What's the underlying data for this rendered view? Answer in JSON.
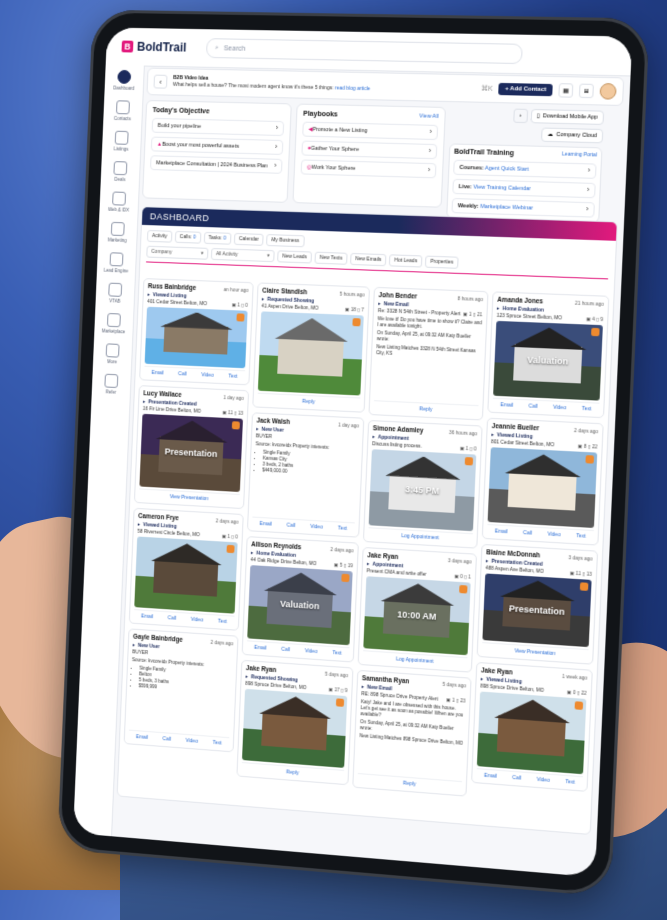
{
  "topbar": {
    "logo": "BoldTrail",
    "search_placeholder": "Search"
  },
  "sidebar": [
    {
      "label": "Dashboard"
    },
    {
      "label": "Contacts"
    },
    {
      "label": "Listings"
    },
    {
      "label": "Deals"
    },
    {
      "label": "Web & IDX"
    },
    {
      "label": "Marketing"
    },
    {
      "label": "Lead Engine"
    },
    {
      "label": "VTAB"
    },
    {
      "label": "Marketplace"
    },
    {
      "label": "More"
    },
    {
      "label": "Refer"
    }
  ],
  "tip": {
    "title": "B2B Video Idea",
    "text": "What helps sell a house? The most modern agent know it's these 5 things:",
    "link": "read blog article",
    "shortcut": "⌘K",
    "add_contact": "Add Contact"
  },
  "objective": {
    "title": "Today's Objective",
    "items": [
      "Build your pipeline",
      "Boost your most powerful assets",
      "Marketplace Consultation | 2024 Business Plan"
    ]
  },
  "playbooks": {
    "title": "Playbooks",
    "view_all": "View All",
    "items": [
      "Promote a New Listing",
      "Gather Your Sphere",
      "Work Your Sphere"
    ]
  },
  "quick": {
    "download": "Download Mobile App",
    "cloud": "Company Cloud"
  },
  "training": {
    "title": "BoldTrail Training",
    "portal": "Learning Portal",
    "rows": [
      {
        "label": "Courses:",
        "link": "Agent Quick Start"
      },
      {
        "label": "Live:",
        "link": "View Training Calendar"
      },
      {
        "label": "Weekly:",
        "link": "Marketplace Webinar"
      }
    ]
  },
  "dashboard": {
    "title": "DASHBOARD",
    "tabs": [
      {
        "label": "Activity",
        "count": ""
      },
      {
        "label": "Calls:",
        "count": "0"
      },
      {
        "label": "Tasks:",
        "count": "0"
      },
      {
        "label": "Calendar",
        "count": ""
      },
      {
        "label": "My Business",
        "count": ""
      }
    ],
    "select_company": "Company",
    "select_activity": "All Activity",
    "quick_filters": [
      "New Leads",
      "New Texts",
      "New Emails",
      "Hot Leads",
      "Properties"
    ]
  },
  "action_labels": {
    "email": "Email",
    "call": "Call",
    "video": "Video",
    "text": "Text",
    "reply": "Reply",
    "view_presentation": "View Presentation",
    "log_appointment": "Log Appointment"
  },
  "columns": [
    [
      {
        "name": "Russ Bainbridge",
        "time": "an hour ago",
        "type": "Viewed Listing",
        "addr": "401 Cedar Street Belton, MO",
        "meta": "▣ 1  ▯ 0",
        "pic": "pool",
        "h": 104,
        "actions": "full"
      },
      {
        "name": "Lucy Wallace",
        "time": "1 day ago",
        "type": "Presentation Created",
        "addr": "16 Fir Line Drive Belton, MO",
        "meta": "▣ 11 ▯ 13",
        "pic": "dusk",
        "overlay": "Presentation",
        "h": 120,
        "actions": "presentation"
      },
      {
        "name": "Cameron Frye",
        "time": "2 days ago",
        "type": "Viewed Listing",
        "addr": "58 Riverrest Circle Belton, MO",
        "meta": "▣ 1 ▯ 0",
        "pic": "aframe",
        "h": 118,
        "actions": "full"
      },
      {
        "name": "Gayle Bainbridge",
        "time": "2 days ago",
        "type": "New User",
        "addr": "BUYER",
        "body": "Source: kvcoreidx Property interests:",
        "list": [
          "Single Family",
          "Belton",
          "5 beds, 3 baths",
          "$599,999"
        ],
        "h": 118,
        "actions": "full"
      }
    ],
    [
      {
        "name": "Claire Standish",
        "time": "5 hours ago",
        "type": "Requested Showing",
        "addr": "41 Aspen Drive Belton, MO",
        "meta": "▣ 18 ▯ 7",
        "pic": "garden",
        "h": 126,
        "actions": "reply"
      },
      {
        "name": "Jack Walsh",
        "time": "1 day ago",
        "type": "New User",
        "addr": "BUYER",
        "body": "Source: kvcoreidx Property interests:",
        "list": [
          "Single Family",
          "Kansas City",
          "3 beds, 2 baths",
          "$449,000.00"
        ],
        "h": 120,
        "actions": "full"
      },
      {
        "name": "Allison Reynolds",
        "time": "2 days ago",
        "type": "Home Evaluation",
        "addr": "44 Oak Ridge Drive Belton, MO",
        "meta": "▣ 5 ▯ 19",
        "pic": "valuation",
        "overlay": "Valuation",
        "h": 120,
        "actions": "full"
      },
      {
        "name": "Jake Ryan",
        "time": "5 days ago",
        "type": "Requested Showing",
        "addr": "898 Spruce Drive Belton, MO",
        "meta": "▣ 17 ▯ 9",
        "pic": "forest",
        "h": 118,
        "actions": "reply"
      }
    ],
    [
      {
        "name": "John Bender",
        "time": "8 hours ago",
        "type": "New Email",
        "addr": "Re: 3328 N 54th Street - Property Alert",
        "meta": "▣ 1 ▯ 21",
        "body": "We love it! Do you have time to show it? Claire and I are available tonight.",
        "body2": "On Sunday, April 25, at 09:32 AM Katy Bueller wrote:",
        "body3": "New Listing Matches 3328 N 54th Street Kansas City, KS",
        "h": 128,
        "actions": "reply"
      },
      {
        "name": "Simone Adamley",
        "time": "36 hours ago",
        "type": "Appointment",
        "addr": "Discuss listing process.",
        "meta": "▣ 1 ▯ 0",
        "pic": "modern",
        "overlay": "3:45 PM",
        "h": 122,
        "actions": "log"
      },
      {
        "name": "Jake Ryan",
        "time": "3 days ago",
        "type": "Appointment",
        "addr": "Present CMA and write offer",
        "meta": "▣ 0 ▯ 1",
        "pic": "craftsman",
        "overlay": "10:00 AM",
        "h": 118,
        "actions": "log"
      },
      {
        "name": "Samantha Ryan",
        "time": "5 days ago",
        "type": "New Email",
        "addr": "RE: 898 Spruce Drive Property Alert",
        "meta": "▣ 1 ▯ 23",
        "body": "Katy! Jake and I are obsessed with this house. Let's get see it as soon as possible! When are you available?",
        "body2": "On Sunday, April 25, at 09:32 AM Katy Bueller wrote:",
        "body3": "New Listing Matches 898 Spruce Drive Belton, MO",
        "h": 118,
        "actions": "reply"
      }
    ],
    [
      {
        "name": "Amanda Jones",
        "time": "21 hours ago",
        "type": "Home Evaluation",
        "addr": "123 Spruce Street Belton, MO",
        "meta": "▣ 4 ▯ 9",
        "pic": "evalnight",
        "overlay": "Valuation",
        "h": 120,
        "actions": "full"
      },
      {
        "name": "Jeannie Bueller",
        "time": "2 days ago",
        "type": "Viewed Listing",
        "addr": "801 Cedar Street Belton, MO",
        "meta": "▣ 8 ▯ 22",
        "pic": "modern2",
        "h": 120,
        "actions": "full"
      },
      {
        "name": "Blaine McDonnah",
        "time": "3 days ago",
        "type": "Presentation Created",
        "addr": "488 Aspen Ave Belton, MO",
        "meta": "▣ 11 ▯ 13",
        "pic": "dusk2",
        "overlay": "Presentation",
        "h": 112,
        "actions": "presentation"
      },
      {
        "name": "Jake Ryan",
        "time": "1 week ago",
        "type": "Viewed Listing",
        "addr": "898 Spruce Drive Belton, MO",
        "meta": "▣ 0 ▯ 22",
        "pic": "forest",
        "h": 120,
        "actions": "full"
      }
    ]
  ]
}
